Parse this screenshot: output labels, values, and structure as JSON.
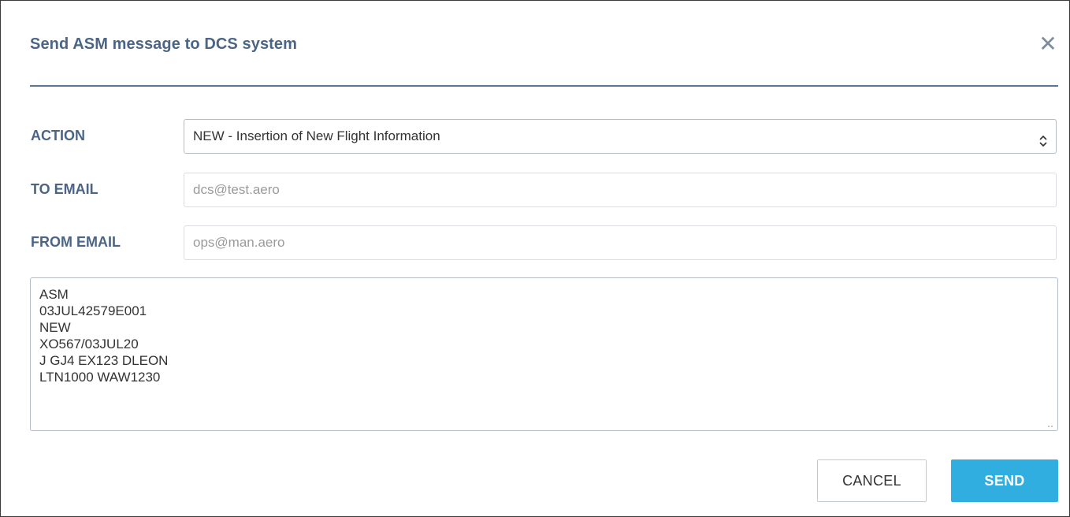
{
  "dialog": {
    "title": "Send ASM message to DCS system",
    "close_icon": "close-icon"
  },
  "form": {
    "action": {
      "label": "ACTION",
      "selected": "NEW - Insertion of New Flight Information"
    },
    "to_email": {
      "label": "TO EMAIL",
      "placeholder": "dcs@test.aero"
    },
    "from_email": {
      "label": "FROM EMAIL",
      "placeholder": "ops@man.aero"
    },
    "message_lines": [
      "ASM",
      "03JUL42579E001",
      "NEW",
      "XO567/03JUL20",
      "J GJ4 EX123 DLEON",
      "LTN1000 WAW1230"
    ]
  },
  "buttons": {
    "cancel": "CANCEL",
    "send": "SEND"
  },
  "colors": {
    "title": "#4a6585",
    "accent": "#30aee0",
    "divider": "#5c7593"
  }
}
